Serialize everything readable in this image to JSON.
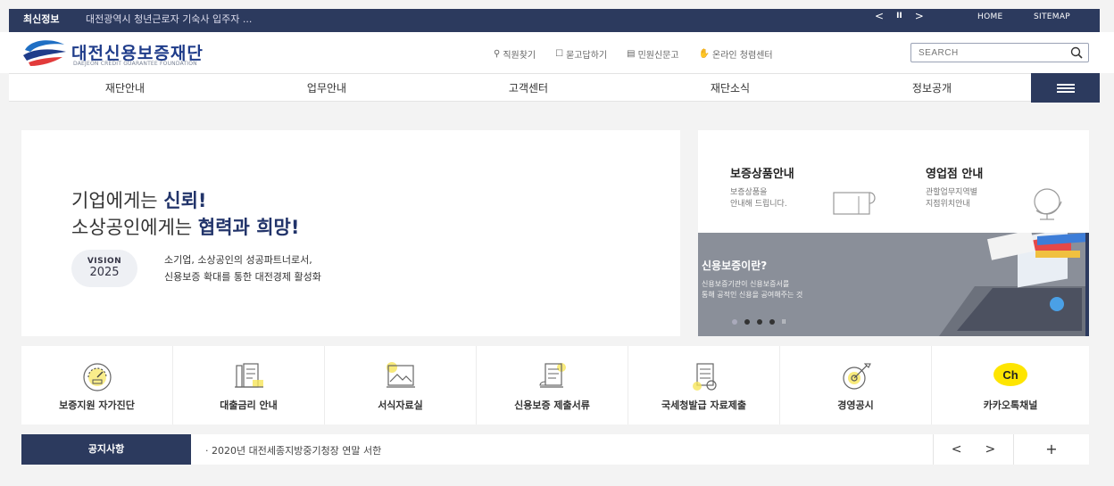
{
  "topbar": {
    "tag": "최신정보",
    "news": "대전광역시 청년근로자 기숙사 입주자 ...",
    "prev": "<",
    "pause": "II",
    "next": ">",
    "home": "HOME",
    "sitemap": "SITEMAP"
  },
  "header": {
    "logo_name": "대전신용보증재단",
    "logo_eng": "DAEJEON CREDIT GUARANTEE FOUNDATION",
    "util": [
      "직원찾기",
      "묻고답하기",
      "민원신문고",
      "온라인 청렴센터"
    ],
    "search_placeholder": "SEARCH"
  },
  "nav": [
    "재단안내",
    "업무안내",
    "고객센터",
    "재단소식",
    "정보공개"
  ],
  "hero": {
    "line1_pre": "기업에게는 ",
    "line1_bold": "신뢰!",
    "line2_pre": "소상공인에게는 ",
    "line2_bold": "협력과 희망!",
    "vision_label": "VISION",
    "vision_year": "2025",
    "desc1": "소기업, 소상공인의 성공파트너로서,",
    "desc2": "신용보증 확대를 통한 대전경제 활성화"
  },
  "cards": [
    {
      "title": "보증상품안내",
      "sub1": "보증상품을",
      "sub2": "안내해 드립니다."
    },
    {
      "title": "영업점 안내",
      "sub1": "관할업무지역별",
      "sub2": "지점위치안내"
    }
  ],
  "banner": {
    "title": "신용보증이란?",
    "sub1": "신용보증기관이 신용보증서를",
    "sub2": "통해 공적인 신용을 공여해주는 것",
    "pause": "II"
  },
  "quick": [
    "보증지원 자가진단",
    "대출금리 안내",
    "서식자료실",
    "신용보증 제출서류",
    "국세청발급 자료제출",
    "경영공시",
    "카카오톡채널"
  ],
  "kakao_badge": "Ch",
  "notice": {
    "title": "공지사항",
    "text": "· 2020년 대전세종지방중기청장 연말 서한",
    "prev": "<",
    "next": ">",
    "more": "+"
  },
  "colors": {
    "navy": "#2c3a5e",
    "brand_blue": "#1f3c8a",
    "highlight_yellow": "#f6e55a",
    "kakao_yellow": "#fee500"
  }
}
